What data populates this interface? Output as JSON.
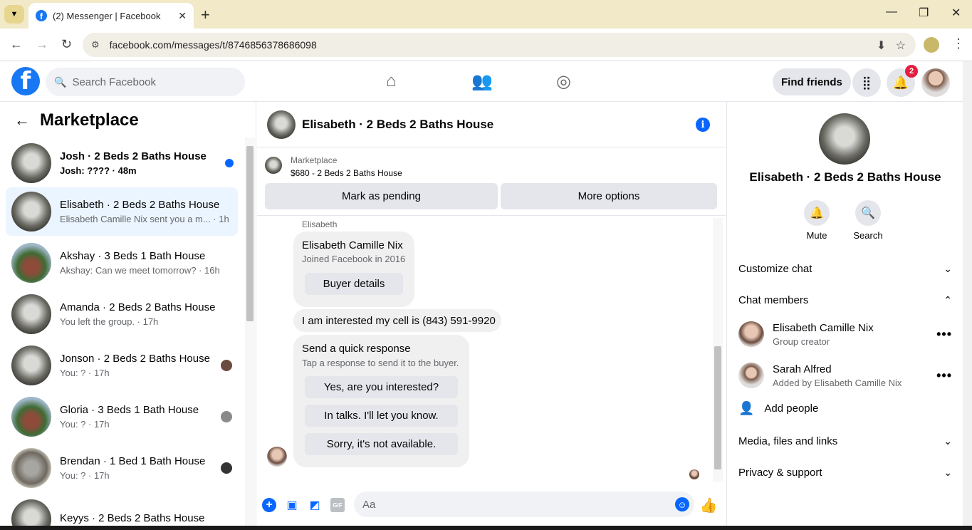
{
  "browser": {
    "tab_title": "(2) Messenger | Facebook",
    "url": "facebook.com/messages/t/8746856378686098"
  },
  "header": {
    "search_placeholder": "Search Facebook",
    "find_friends": "Find friends",
    "notifications_count": "2"
  },
  "left": {
    "title": "Marketplace",
    "conversations": [
      {
        "name": "Josh · 2 Beds 2 Baths House",
        "preview": "Josh: ???? · 48m",
        "unread": true
      },
      {
        "name": "Elisabeth · 2 Beds 2 Baths House",
        "preview": "Elisabeth Camille Nix sent you a m... · 1h",
        "active": true
      },
      {
        "name": "Akshay · 3 Beds 1 Bath House",
        "preview": "Akshay: Can we meet tomorrow? · 16h"
      },
      {
        "name": "Amanda · 2 Beds 2 Baths House",
        "preview": "You left the group. · 17h"
      },
      {
        "name": "Jonson · 2 Beds 2 Baths House",
        "preview": "You: ? · 17h"
      },
      {
        "name": "Gloria · 3 Beds 1 Bath House",
        "preview": "You: ? · 17h"
      },
      {
        "name": "Brendan · 1 Bed 1 Bath House",
        "preview": "You: ? · 17h"
      },
      {
        "name": "Keyys · 2 Beds 2 Baths House",
        "preview": ""
      }
    ]
  },
  "chat": {
    "title": "Elisabeth · 2 Beds 2 Baths House",
    "listing_source": "Marketplace",
    "listing_price": "$680 - 2 Beds 2 Baths House",
    "mark_pending": "Mark as pending",
    "more_options": "More options",
    "sender_label": "Elisabeth",
    "profile_card_name": "Elisabeth Camille Nix",
    "profile_card_joined": "Joined Facebook in 2016",
    "buyer_details": "Buyer details",
    "message_text": "I am interested my cell is (843) 591-9920",
    "quick_title": "Send a quick response",
    "quick_hint": "Tap a response to send it to the buyer.",
    "quick_responses": [
      "Yes, are you interested?",
      "In talks. I'll let you know.",
      "Sorry, it's not available."
    ],
    "composer_placeholder": "Aa"
  },
  "right": {
    "name": "Elisabeth · 2 Beds 2 Baths House",
    "mute": "Mute",
    "search": "Search",
    "customize_chat": "Customize chat",
    "chat_members": "Chat members",
    "members": [
      {
        "name": "Elisabeth Camille Nix",
        "role": "Group creator"
      },
      {
        "name": "Sarah Alfred",
        "role": "Added by Elisabeth Camille Nix"
      }
    ],
    "add_people": "Add people",
    "media_files_links": "Media, files and links",
    "privacy_support": "Privacy & support"
  }
}
